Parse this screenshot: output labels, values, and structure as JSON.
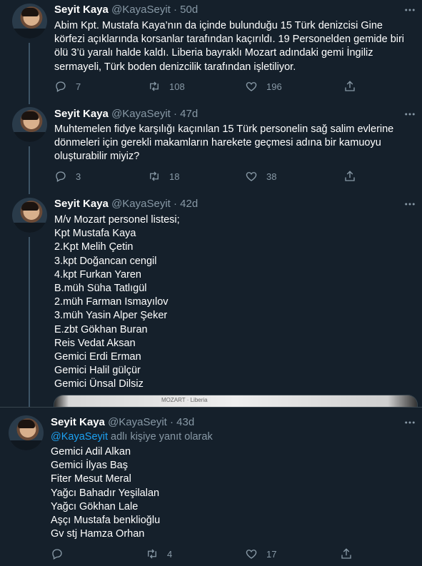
{
  "author": {
    "name": "Seyit Kaya",
    "handle": "@KayaSeyit",
    "separator": "·"
  },
  "tweets": [
    {
      "time": "50d",
      "text": "Abim Kpt. Mustafa Kaya’nın da içinde bulunduğu 15 Türk denizcisi Gine körfezi açıklarında korsanlar tarafından kaçırıldı. 19 Personelden gemide biri ölü 3’ü yaralı halde kaldı. Liberia bayraklı Mozart adındaki gemi İngiliz sermayeli, Türk boden denizcilik tarafından işletiliyor.",
      "replies": "7",
      "retweets": "108",
      "likes": "196"
    },
    {
      "time": "47d",
      "text": "Muhtemelen fidye karşılığı kaçınılan 15 Türk personelin sağ salim evlerine dönmeleri için gerekli makamların harekete geçmesi adına bir kamuoyu oluşturabilir miyiz?",
      "replies": "3",
      "retweets": "18",
      "likes": "38"
    },
    {
      "time": "42d",
      "lines": [
        "M/v Mozart personel listesi;",
        "Kpt Mustafa Kaya",
        "2.Kpt Melih Çetin",
        "3.kpt Doğancan cengil",
        "4.kpt Furkan Yaren",
        "B.müh Süha Tatlıgül",
        "2.müh Farman Ismayılov",
        "3.müh Yasin Alper Şeker",
        "E.zbt Gökhan Buran",
        "Reis Vedat Aksan",
        "Gemici Erdi Erman",
        "Gemici Halil gülçür",
        "Gemici Ünsal Dilsiz"
      ],
      "media_text": "MOZART · Liberia"
    },
    {
      "time": "43d",
      "reply_mention": "@KayaSeyit",
      "reply_suffix": " adlı kişiye yanıt olarak",
      "lines": [
        "Gemici Adil Alkan",
        "Gemici İlyas Baş",
        "Fiter Mesut Meral",
        "Yağcı Bahadır Yeşilalan",
        "Yağcı Gökhan Lale",
        "Aşçı Mustafa benklioğlu",
        "Gv stj Hamza Orhan"
      ],
      "replies": "",
      "retweets": "4",
      "likes": "17"
    }
  ],
  "colors": {
    "background": "#15202b",
    "secondary": "#8899a6",
    "link": "#1da1f2",
    "divider": "#38444d"
  },
  "icons": [
    "reply-icon",
    "retweet-icon",
    "like-icon",
    "share-icon",
    "more-icon"
  ]
}
